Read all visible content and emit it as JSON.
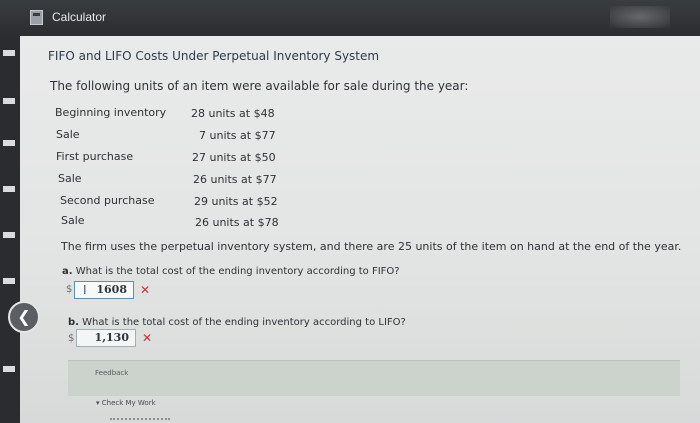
{
  "window": {
    "title": "Calculator"
  },
  "header": {
    "title": "FIFO and LIFO Costs Under Perpetual Inventory System"
  },
  "intro": "The following units of an item were available for sale during the year:",
  "inventory": [
    {
      "label": "Beginning inventory",
      "value": "28 units at $48"
    },
    {
      "label": "Sale",
      "value": "7 units at $77"
    },
    {
      "label": "First purchase",
      "value": "27 units at $50"
    },
    {
      "label": "Sale",
      "value": "26 units at $77"
    },
    {
      "label": "Second purchase",
      "value": "29 units at $52"
    },
    {
      "label": "Sale",
      "value": "26 units at $78"
    }
  ],
  "statement": "The firm uses the perpetual inventory system, and there are 25 units of the item on hand at the end of the year.",
  "questions": [
    {
      "letter": "a.",
      "text": "What is the total cost of the ending inventory according to FIFO?",
      "currency": "$",
      "value": "1608",
      "mark": "✕"
    },
    {
      "letter": "b.",
      "text": "What is the total cost of the ending inventory according to LIFO?",
      "currency": "$",
      "value": "1,130",
      "mark": "✕"
    }
  ],
  "feedback": {
    "label": "Feedback",
    "check_work": "▾ Check My Work"
  },
  "icons": {
    "app": "calculator-icon",
    "back": "chevron-left-icon"
  },
  "colors": {
    "error": "#d0322d",
    "title_bar": "#2b2d30"
  }
}
